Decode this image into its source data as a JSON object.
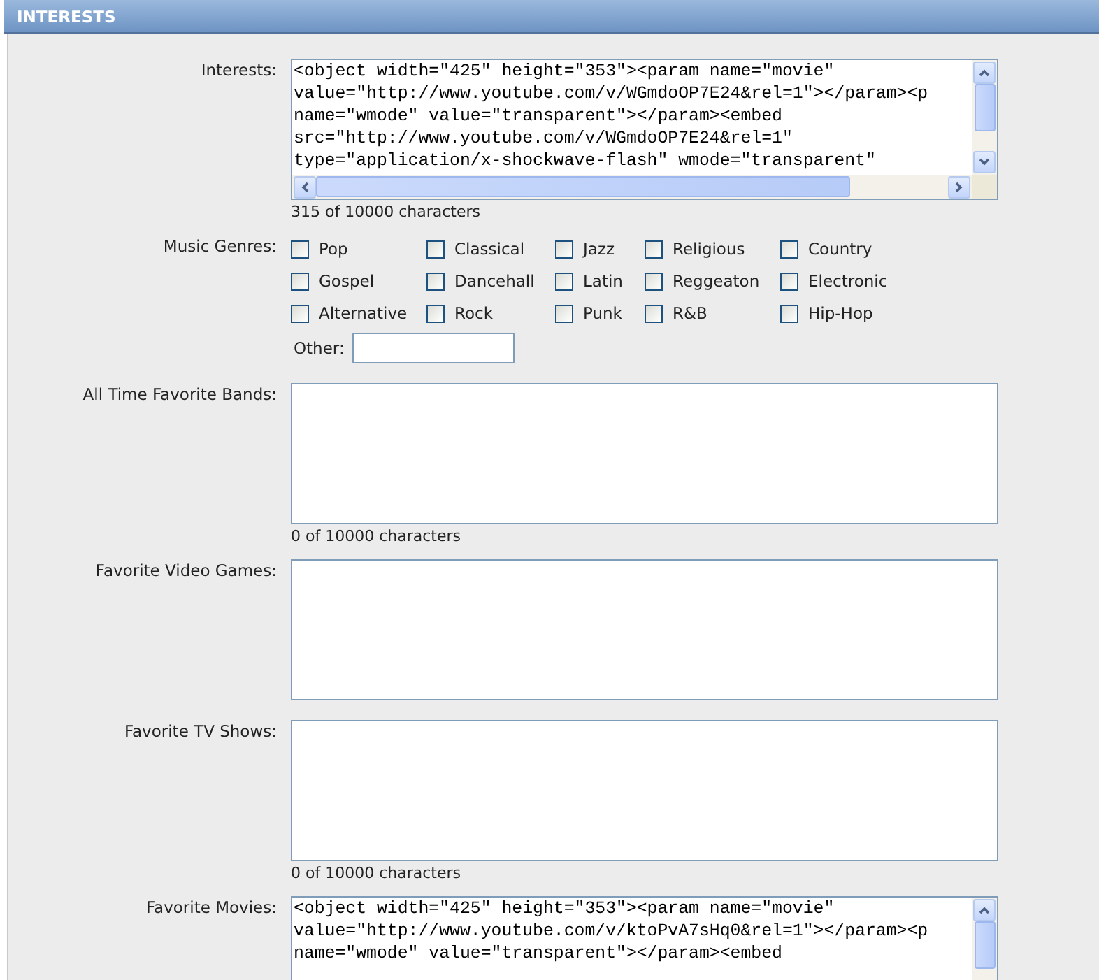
{
  "section": {
    "title": "INTERESTS"
  },
  "fields": [
    {
      "kind": "code",
      "label": "Interests:",
      "lines": [
        "<object width=\"425\" height=\"353\"><param name=\"movie\"",
        "value=\"http://www.youtube.com/v/WGmdoOP7E24&rel=1\"></param><p",
        "name=\"wmode\" value=\"transparent\"></param><embed",
        "src=\"http://www.youtube.com/v/WGmdoOP7E24&rel=1\"",
        "type=\"application/x-shockwave-flash\" wmode=\"transparent\""
      ],
      "counter": "315 of 10000 characters"
    },
    {
      "kind": "genres",
      "label": "Music Genres:",
      "genres": [
        {
          "label": "Pop",
          "checked": false
        },
        {
          "label": "Classical",
          "checked": false
        },
        {
          "label": "Jazz",
          "checked": false
        },
        {
          "label": "Religious",
          "checked": false
        },
        {
          "label": "Country",
          "checked": false
        },
        {
          "label": "Gospel",
          "checked": false
        },
        {
          "label": "Dancehall",
          "checked": false
        },
        {
          "label": "Latin",
          "checked": false
        },
        {
          "label": "Reggeaton",
          "checked": false
        },
        {
          "label": "Electronic",
          "checked": false
        },
        {
          "label": "Alternative",
          "checked": false
        },
        {
          "label": "Rock",
          "checked": false
        },
        {
          "label": "Punk",
          "checked": false
        },
        {
          "label": "R&B",
          "checked": false
        },
        {
          "label": "Hip-Hop",
          "checked": false
        }
      ],
      "other_label": "Other:"
    },
    {
      "kind": "text",
      "label": "All Time Favorite Bands:",
      "counter": "0 of 10000 characters"
    },
    {
      "kind": "text",
      "label": "Favorite Video Games:"
    },
    {
      "kind": "text",
      "label": "Favorite TV Shows:",
      "counter": "0 of 10000 characters"
    },
    {
      "kind": "code",
      "label": "Favorite Movies:",
      "lines": [
        "<object width=\"425\" height=\"353\"><param name=\"movie\"",
        "value=\"http://www.youtube.com/v/ktoPvA7sHq0&rel=1\"></param><p",
        "name=\"wmode\" value=\"transparent\"></param><embed"
      ]
    }
  ]
}
